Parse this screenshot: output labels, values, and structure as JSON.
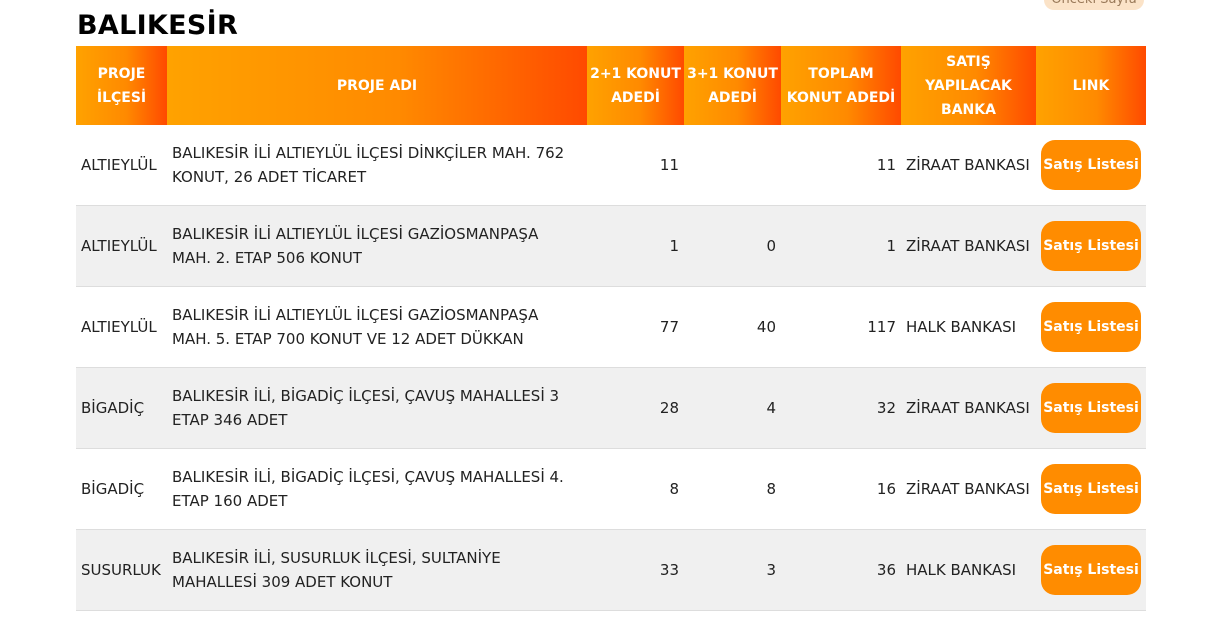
{
  "nav": {
    "prev_page_label": "Önceki Sayfa"
  },
  "page": {
    "title": "BALIKESİR"
  },
  "table": {
    "headers": [
      {
        "line1": "PROJE",
        "line2": "İLÇESİ"
      },
      {
        "line1": "PROJE ADI",
        "line2": ""
      },
      {
        "line1": "2+1 KONUT",
        "line2": "ADEDİ"
      },
      {
        "line1": "3+1 KONUT",
        "line2": "ADEDİ"
      },
      {
        "line1": "TOPLAM",
        "line2": "KONUT ADEDİ"
      },
      {
        "line1": "SATIŞ YAPILACAK",
        "line2": "BANKA"
      },
      {
        "line1": "LINK",
        "line2": ""
      }
    ],
    "rows": [
      {
        "ilce": "ALTIEYLÜL",
        "ad": "BALIKESİR İLİ ALTIEYLÜL İLÇESİ DİNKÇİLER MAH. 762 KONUT, 26 ADET TİCARET",
        "k21": "11",
        "k31": "",
        "toplam": "11",
        "banka": "ZİRAAT BANKASI",
        "link": "Satış Listesi"
      },
      {
        "ilce": "ALTIEYLÜL",
        "ad": "BALIKESİR İLİ ALTIEYLÜL İLÇESİ GAZİOSMANPAŞA MAH. 2. ETAP 506 KONUT",
        "k21": "1",
        "k31": "0",
        "toplam": "1",
        "banka": "ZİRAAT BANKASI",
        "link": "Satış Listesi"
      },
      {
        "ilce": "ALTIEYLÜL",
        "ad": "BALIKESİR İLİ ALTIEYLÜL İLÇESİ GAZİOSMANPAŞA MAH. 5. ETAP 700 KONUT VE 12 ADET DÜKKAN",
        "k21": "77",
        "k31": "40",
        "toplam": "117",
        "banka": "HALK BANKASI",
        "link": "Satış Listesi"
      },
      {
        "ilce": "BİGADİÇ",
        "ad": "BALIKESİR İLİ, BİGADİÇ İLÇESİ, ÇAVUŞ MAHALLESİ 3 ETAP 346 ADET",
        "k21": "28",
        "k31": "4",
        "toplam": "32",
        "banka": "ZİRAAT BANKASI",
        "link": "Satış Listesi"
      },
      {
        "ilce": "BİGADİÇ",
        "ad": "BALIKESİR İLİ, BİGADİÇ İLÇESİ, ÇAVUŞ MAHALLESİ 4. ETAP 160 ADET",
        "k21": "8",
        "k31": "8",
        "toplam": "16",
        "banka": "ZİRAAT BANKASI",
        "link": "Satış Listesi"
      },
      {
        "ilce": "SUSURLUK",
        "ad": "BALIKESİR İLİ, SUSURLUK İLÇESİ, SULTANİYE MAHALLESİ 309 ADET KONUT",
        "k21": "33",
        "k31": "3",
        "toplam": "36",
        "banka": "HALK BANKASI",
        "link": "Satış Listesi"
      }
    ]
  },
  "colors": {
    "header_gradient_start": "#ffa200",
    "header_gradient_end": "#ff4a00",
    "button": "#ff8c00",
    "row_alt": "#f0f0f0"
  }
}
